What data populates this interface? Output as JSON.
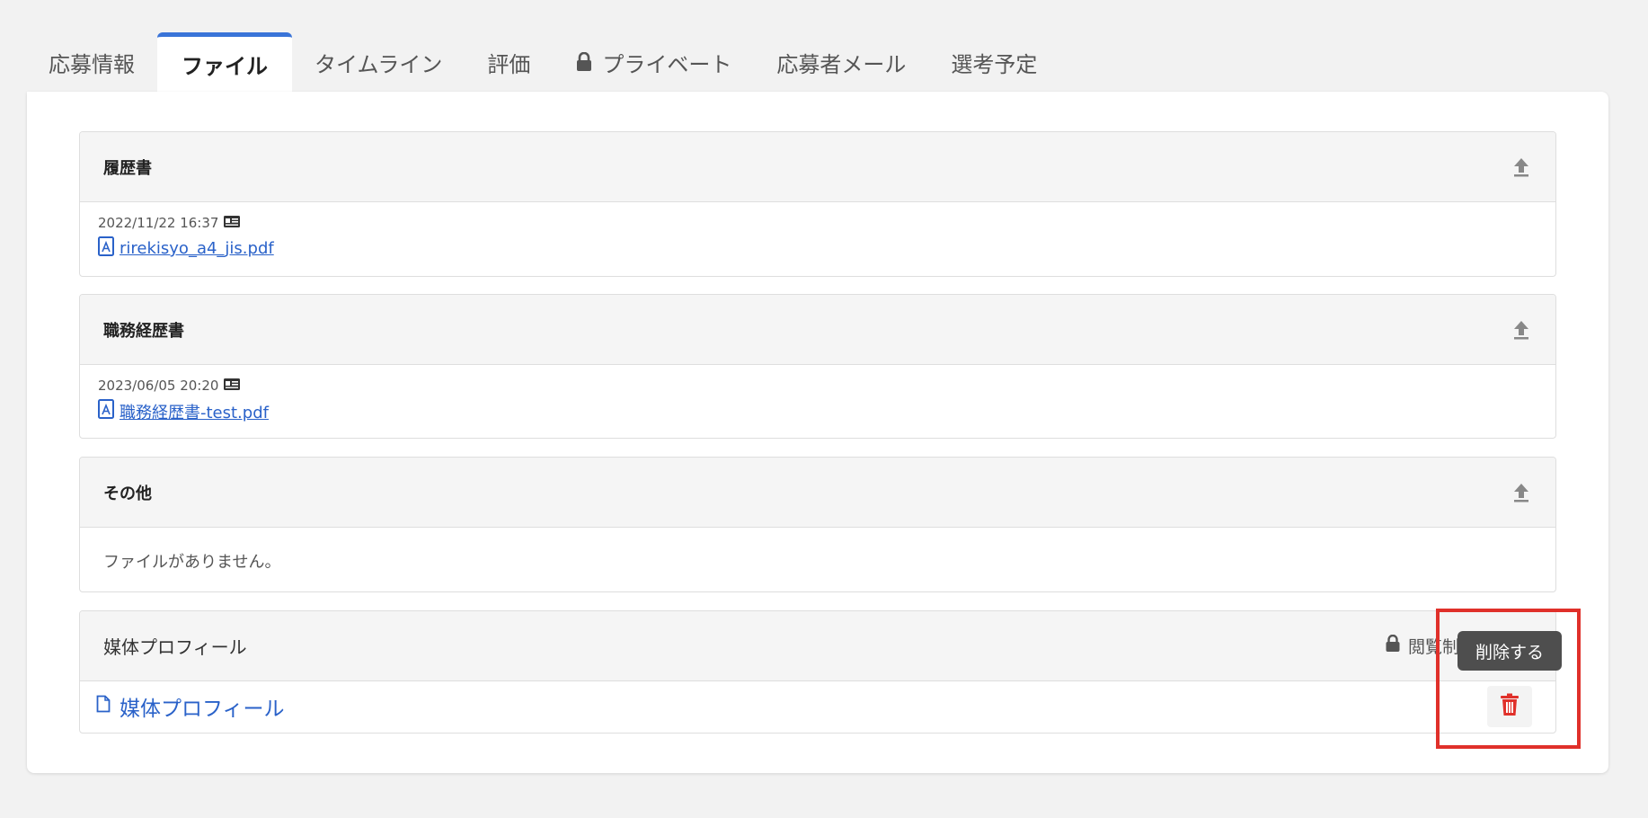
{
  "tabs": [
    {
      "label": "応募情報",
      "active": false
    },
    {
      "label": "ファイル",
      "active": true
    },
    {
      "label": "タイムライン",
      "active": false
    },
    {
      "label": "評価",
      "active": false
    },
    {
      "label": "プライベート",
      "active": false,
      "icon": "lock-icon"
    },
    {
      "label": "応募者メール",
      "active": false
    },
    {
      "label": "選考予定",
      "active": false
    }
  ],
  "panels": {
    "resume": {
      "title": "履歴書",
      "date": "2022/11/22 16:37",
      "file_name": "rirekisyo_a4_jis.pdf"
    },
    "work_history": {
      "title": "職務経歴書",
      "date": "2023/06/05 20:20",
      "file_name": "職務経歴書-test.pdf"
    },
    "other": {
      "title": "その他",
      "empty_message": "ファイルがありません。"
    },
    "media_profile": {
      "title": "媒体プロフィール",
      "restriction_label": "閲覧制限",
      "link_label": "媒体プロフィール"
    }
  },
  "tooltip": {
    "text": "削除する"
  },
  "colors": {
    "accent": "#3a74d8",
    "link": "#2a62c9",
    "delete": "#e0302a",
    "highlight_box": "#e0302a"
  }
}
